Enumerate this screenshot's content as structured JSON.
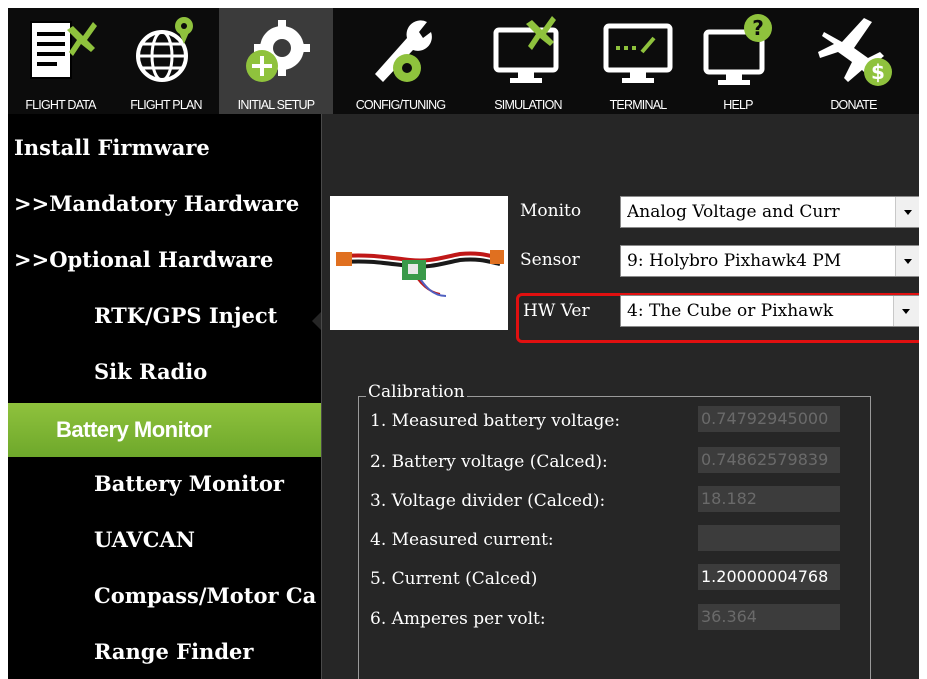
{
  "toolbar": {
    "items": [
      {
        "label": "FLIGHT DATA",
        "icon": "flight-data-icon"
      },
      {
        "label": "FLIGHT PLAN",
        "icon": "flight-plan-icon"
      },
      {
        "label": "INITIAL SETUP",
        "icon": "initial-setup-icon",
        "active": true
      },
      {
        "label": "CONFIG/TUNING",
        "icon": "config-tuning-icon"
      },
      {
        "label": "SIMULATION",
        "icon": "simulation-icon"
      },
      {
        "label": "TERMINAL",
        "icon": "terminal-icon"
      },
      {
        "label": "HELP",
        "icon": "help-icon"
      },
      {
        "label": "DONATE",
        "icon": "donate-icon"
      }
    ],
    "accent": "#8fc23d"
  },
  "menu": {
    "items": [
      {
        "label": "Install Firmware"
      },
      {
        "label": ">>Mandatory Hardware"
      },
      {
        "label": ">>Optional Hardware"
      },
      {
        "label": "RTK/GPS Inject"
      },
      {
        "label": "Sik Radio"
      },
      {
        "label": "Battery Monitor",
        "selected": true
      },
      {
        "label": "Battery Monitor"
      },
      {
        "label": "UAVCAN"
      },
      {
        "label": "Compass/Motor Ca"
      },
      {
        "label": "Range Finder"
      }
    ]
  },
  "battery": {
    "monitor_label": "Monito",
    "monitor_value": "Analog Voltage and Curr",
    "sensor_label": "Sensor",
    "sensor_value": "9: Holybro Pixhawk4 PM",
    "hwver_label": "HW Ver",
    "hwver_value": "4: The Cube or Pixhawk",
    "highlight_color": "#e01010"
  },
  "calibration": {
    "title": "Calibration",
    "rows": [
      {
        "label": "1. Measured battery voltage:",
        "value": "0.74792945000"
      },
      {
        "label": "2. Battery voltage (Calced):",
        "value": "0.74862579839"
      },
      {
        "label": "3. Voltage divider (Calced):",
        "value": "18.182"
      },
      {
        "label": "4. Measured current:",
        "value": ""
      },
      {
        "label": "5. Current (Calced)",
        "value": "1.20000004768"
      },
      {
        "label": "6. Amperes per volt:",
        "value": "36.364"
      }
    ]
  }
}
